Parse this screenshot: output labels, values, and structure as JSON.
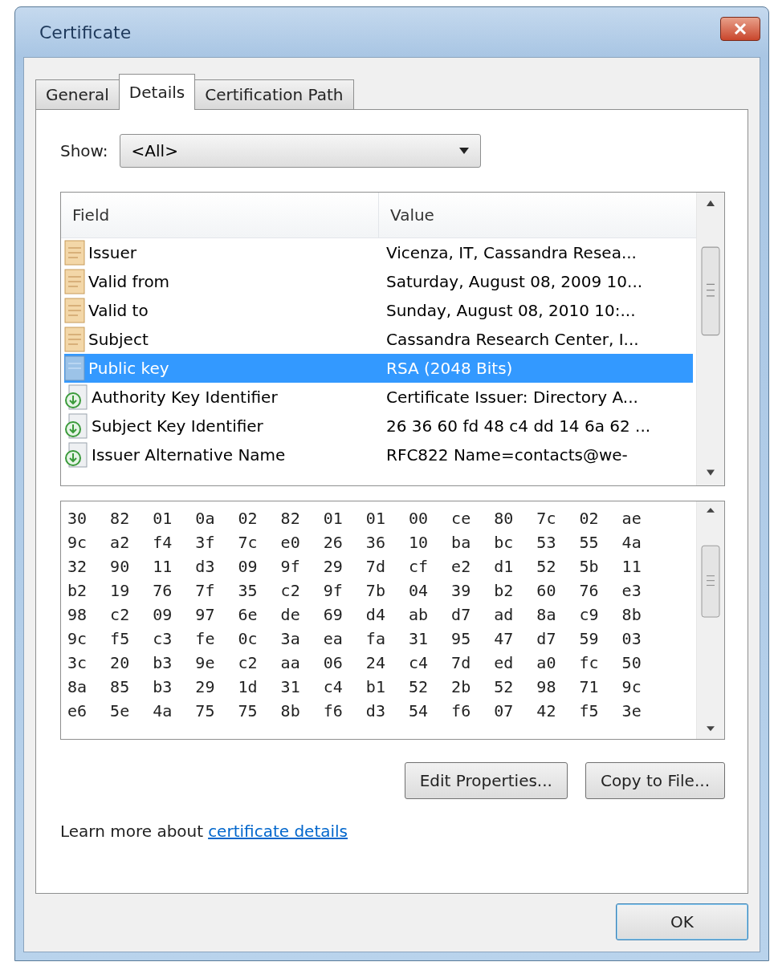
{
  "window": {
    "title": "Certificate"
  },
  "tabs": [
    {
      "label": "General",
      "selected": false
    },
    {
      "label": "Details",
      "selected": true
    },
    {
      "label": "Certification Path",
      "selected": false
    }
  ],
  "show": {
    "label": "Show:",
    "value": "<All>"
  },
  "fields_table": {
    "columns": [
      "Field",
      "Value"
    ],
    "rows": [
      {
        "kind": "attribute",
        "field": "Issuer",
        "value": "Vicenza, IT, Cassandra Resea...",
        "selected": false
      },
      {
        "kind": "attribute",
        "field": "Valid from",
        "value": "Saturday, August 08, 2009 10...",
        "selected": false
      },
      {
        "kind": "attribute",
        "field": "Valid to",
        "value": "Sunday, August 08, 2010 10:...",
        "selected": false
      },
      {
        "kind": "attribute",
        "field": "Subject",
        "value": "Cassandra Research Center, I...",
        "selected": false
      },
      {
        "kind": "key",
        "field": "Public key",
        "value": "RSA (2048 Bits)",
        "selected": true
      },
      {
        "kind": "extension",
        "field": "Authority Key Identifier",
        "value": "Certificate Issuer: Directory A...",
        "selected": false
      },
      {
        "kind": "extension",
        "field": "Subject Key Identifier",
        "value": "26 36 60 fd 48 c4 dd 14 6a 62 ...",
        "selected": false
      },
      {
        "kind": "extension",
        "field": "Issuer Alternative Name",
        "value": "RFC822 Name=contacts@we-",
        "selected": false
      }
    ]
  },
  "value_lines": [
    "30 82 01 0a 02 82 01 01 00 ce 80 7c 02 ae",
    "9c a2 f4 3f 7c e0 26 36 10 ba bc 53 55 4a",
    "32 90 11 d3 09 9f 29 7d cf e2 d1 52 5b 11",
    "b2 19 76 7f 35 c2 9f 7b 04 39 b2 60 76 e3",
    "98 c2 09 97 6e de 69 d4 ab d7 ad 8a c9 8b",
    "9c f5 c3 fe 0c 3a ea fa 31 95 47 d7 59 03",
    "3c 20 b3 9e c2 aa 06 24 c4 7d ed a0 fc 50",
    "8a 85 b3 29 1d 31 c4 b1 52 2b 52 98 71 9c",
    "e6 5e 4a 75 75 8b f6 d3 54 f6 07 42 f5 3e"
  ],
  "buttons": [
    "Edit Properties...",
    "Copy to File..."
  ],
  "learn_more": {
    "text": "Learn more about",
    "link": "certificate details"
  },
  "ok_button": "OK"
}
